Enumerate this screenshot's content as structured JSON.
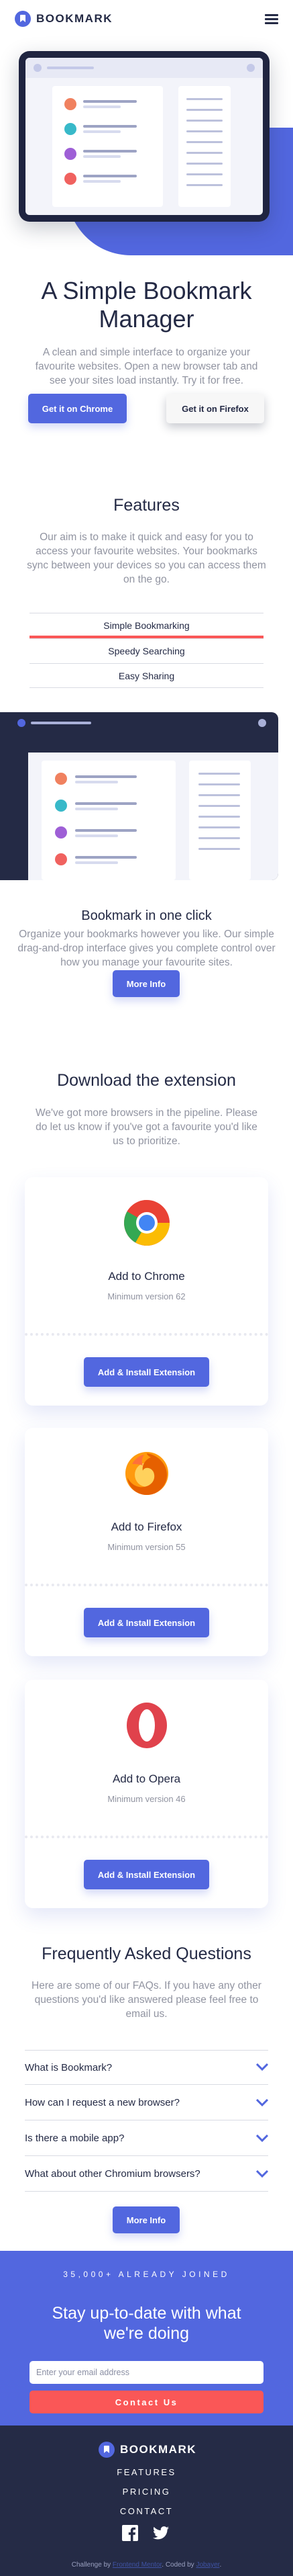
{
  "header": {
    "logo_text": "BOOKMARK",
    "menu_icon": "hamburger-icon"
  },
  "hero": {
    "title": "A Simple Bookmark Manager",
    "description": "A clean and simple interface to organize your favourite websites. Open a new browser tab and see your sites load instantly. Try it for free.",
    "chrome_button": "Get it on Chrome",
    "firefox_button": "Get it on Firefox"
  },
  "features": {
    "title": "Features",
    "description": "Our aim is to make it quick and easy for you to access your favourite websites. Your bookmarks sync between your devices so you can access them on the go.",
    "tabs": [
      {
        "label": "Simple Bookmarking",
        "active": true
      },
      {
        "label": "Speedy Searching",
        "active": false
      },
      {
        "label": "Easy Sharing",
        "active": false
      }
    ],
    "panel_title": "Bookmark in one click",
    "panel_description": "Organize your bookmarks however you like. Our simple drag-and-drop interface gives you complete control over how you manage your favourite sites.",
    "more_info_button": "More Info"
  },
  "download": {
    "title": "Download the extension",
    "description": "We've got more browsers in the pipeline. Please do let us know if you've got a favourite you'd like us to prioritize.",
    "cards": [
      {
        "title": "Add to Chrome",
        "min_version": "Minimum version 62",
        "button": "Add & Install Extension",
        "icon": "chrome-logo-icon"
      },
      {
        "title": "Add to Firefox",
        "min_version": "Minimum version 55",
        "button": "Add & Install Extension",
        "icon": "firefox-logo-icon"
      },
      {
        "title": "Add to Opera",
        "min_version": "Minimum version 46",
        "button": "Add & Install Extension",
        "icon": "opera-logo-icon"
      }
    ]
  },
  "faq": {
    "title": "Frequently Asked Questions",
    "description": "Here are some of our FAQs. If you have any other questions you'd like answered please feel free to email us.",
    "questions": [
      "What is Bookmark?",
      "How can I request a new browser?",
      "Is there a mobile app?",
      "What about other Chromium browsers?"
    ],
    "more_info_button": "More Info"
  },
  "contact": {
    "count_text": "35,000+ ALREADY JOINED",
    "title": "Stay up-to-date with what we're doing",
    "email_placeholder": "Enter your email address",
    "button": "Contact Us"
  },
  "footer": {
    "logo_text": "BOOKMARK",
    "links": [
      "FEATURES",
      "PRICING",
      "CONTACT"
    ],
    "social_icons": [
      "facebook-icon",
      "twitter-icon"
    ],
    "attribution_prefix": "Challenge by ",
    "attribution_link1": "Frontend Mentor",
    "attribution_mid": ". Coded by ",
    "attribution_link2": "Jobayer",
    "attribution_suffix": "."
  },
  "colors": {
    "primary": "#5267df",
    "secondary": "#fa5757",
    "dark": "#242a45",
    "grey": "#9194a1"
  }
}
